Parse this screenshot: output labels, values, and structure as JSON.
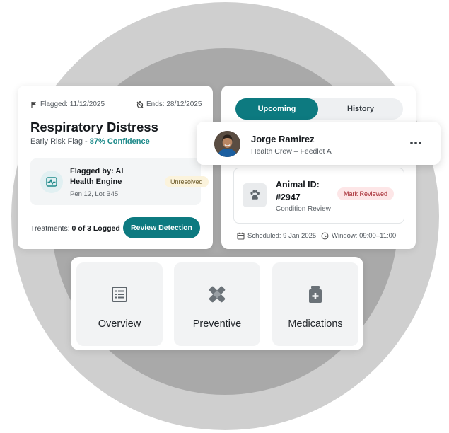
{
  "risk_card": {
    "flagged_date": "Flagged: 11/12/2025",
    "ends_date": "Ends: 28/12/2025",
    "title": "Respiratory Distress",
    "subtitle_prefix": "Early Risk Flag - ",
    "confidence": "87% Confidence",
    "engine_label": "Flagged by: AI Health Engine",
    "location": "Pen 12, Lot B45",
    "status_badge": "Unresolved",
    "treatments_prefix": "Treatments: ",
    "treatments_count": "0 of 3 Logged",
    "review_button": "Review Detection"
  },
  "schedule_card": {
    "tabs": [
      {
        "label": "Upcoming",
        "active": true
      },
      {
        "label": "History",
        "active": false
      }
    ],
    "animal_id": "Animal ID: #2947",
    "condition": "Condition Review",
    "mark_button": "Mark Reviewed",
    "scheduled": "Scheduled: 9 Jan 2025",
    "window": "Window: 09:00–11:00"
  },
  "person_card": {
    "name": "Jorge Ramirez",
    "role": "Health Crew – Feedlot A"
  },
  "nav_tiles": [
    {
      "label": "Overview",
      "icon": "list-icon"
    },
    {
      "label": "Preventive",
      "icon": "bandage-icon"
    },
    {
      "label": "Medications",
      "icon": "medicine-bottle-icon"
    }
  ],
  "colors": {
    "accent": "#0d7a80",
    "confidence": "#1d8a8a",
    "warning_bg": "#fbf3dc",
    "danger_text": "#a3262e",
    "danger_bg": "#fde6e7",
    "circle_outer": "#cfcfcf",
    "circle_inner": "#a9a9a9"
  }
}
